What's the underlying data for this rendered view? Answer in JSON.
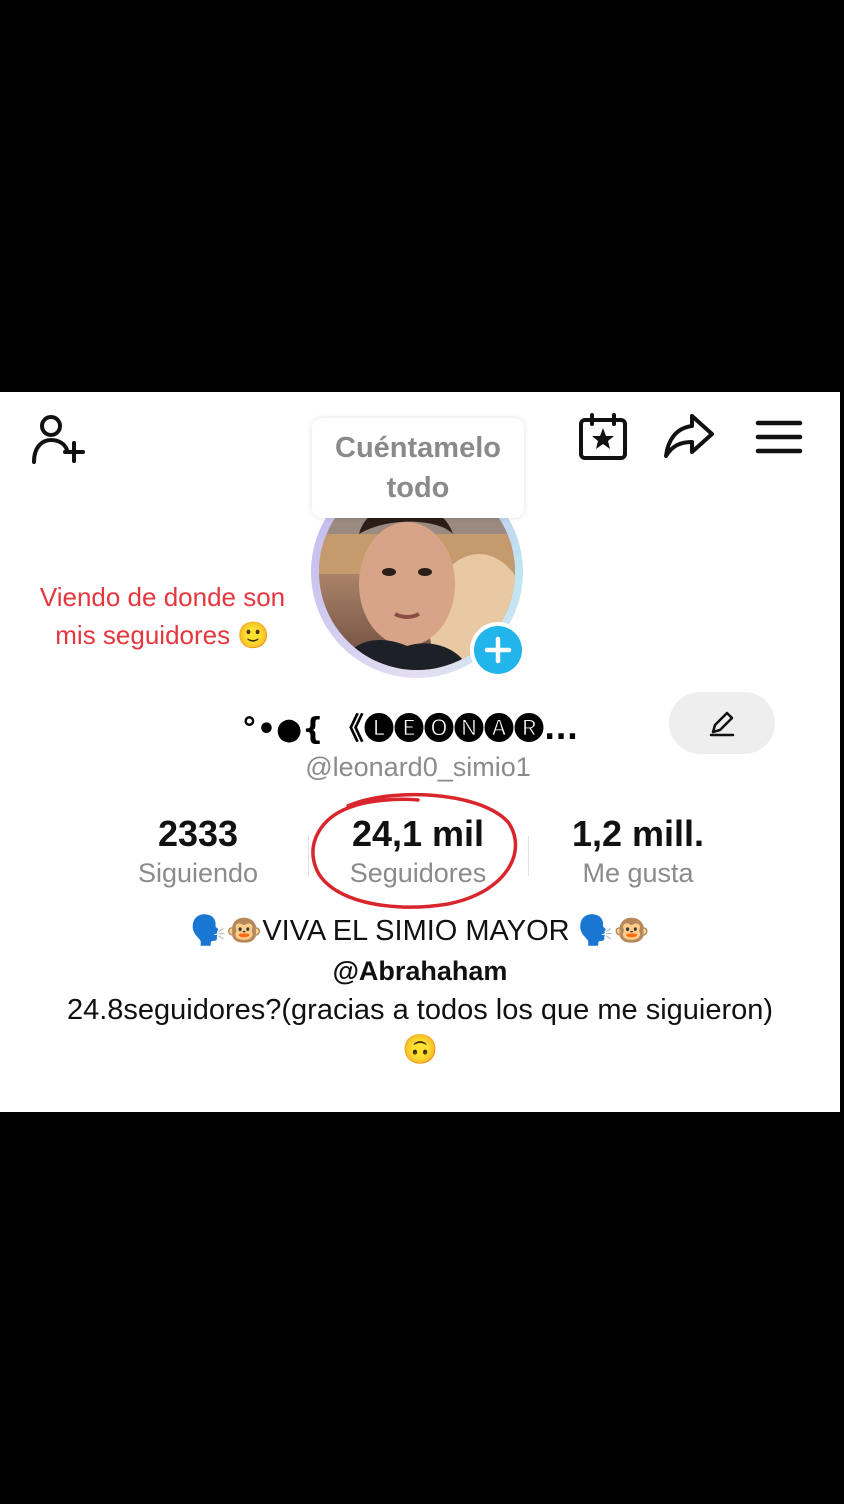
{
  "header": {
    "bubble_text": "Cuéntamelo todo",
    "icons": [
      "add-user-icon",
      "calendar-star-icon",
      "share-icon",
      "menu-icon"
    ]
  },
  "overlay": {
    "caption": "Viendo de donde son mis seguidores 🙂"
  },
  "profile": {
    "display_name": "°•●{ 《🅛🅔🅞🅝🅐🅡...",
    "username": "@leonard0_simio1",
    "stats": {
      "following_value": "2333",
      "following_label": "Siguiendo",
      "followers_value": "24,1 mil",
      "followers_label": "Seguidores",
      "likes_value": "1,2 mill.",
      "likes_label": "Me gusta"
    },
    "bio_line1": "🗣️🐵VIVA EL SIMIO MAYOR 🗣️🐵",
    "bio_mention": "@Abrahaham",
    "bio_text": "24.8seguidores?(gracias a todos los que me siguieron)🙃"
  },
  "colors": {
    "accent_red": "#e4373e",
    "add_blue": "#21b5eb"
  }
}
